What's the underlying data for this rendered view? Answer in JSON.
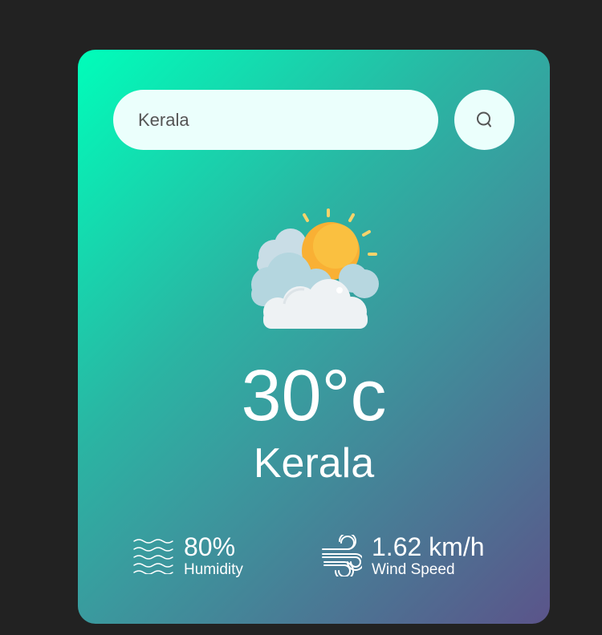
{
  "search": {
    "value": "Kerala",
    "icon": "search-icon"
  },
  "weather": {
    "icon": "partly-cloudy-icon",
    "temperature": "30°c",
    "city": "Kerala"
  },
  "details": {
    "humidity": {
      "value": "80%",
      "label": "Humidity",
      "icon": "humidity-waves-icon"
    },
    "wind": {
      "value": "1.62 km/h",
      "label": "Wind Speed",
      "icon": "wind-icon"
    }
  },
  "colors": {
    "page_background": "#222222",
    "gradient_start": "#00feba",
    "gradient_end": "#5b548a",
    "input_background": "#ebfffc",
    "text": "#ffffff"
  }
}
